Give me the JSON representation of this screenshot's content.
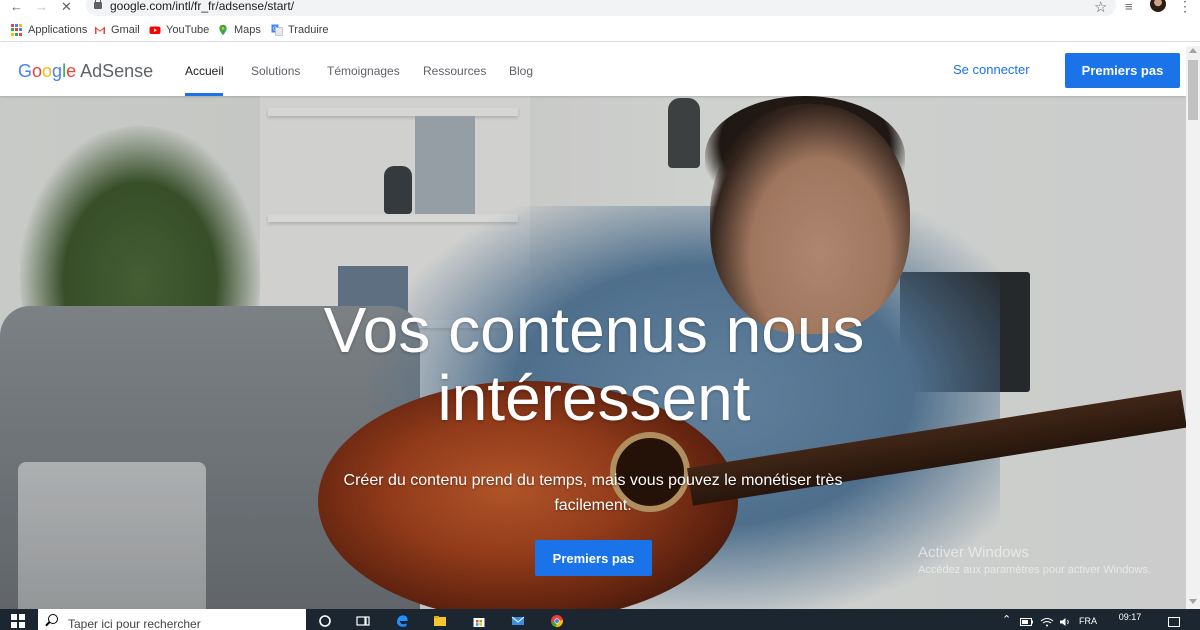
{
  "browser": {
    "url": "google.com/intl/fr_fr/adsense/start/",
    "bookmarks": [
      {
        "label": "Applications",
        "icon": "apps-grid-icon"
      },
      {
        "label": "Gmail",
        "icon": "gmail-icon"
      },
      {
        "label": "YouTube",
        "icon": "youtube-icon"
      },
      {
        "label": "Maps",
        "icon": "maps-pin-icon"
      },
      {
        "label": "Traduire",
        "icon": "translate-icon"
      }
    ]
  },
  "header": {
    "logo_google": [
      "G",
      "o",
      "o",
      "g",
      "l",
      "e"
    ],
    "logo_product": "AdSense",
    "nav": [
      {
        "label": "Accueil",
        "active": true
      },
      {
        "label": "Solutions",
        "active": false
      },
      {
        "label": "Témoignages",
        "active": false
      },
      {
        "label": "Ressources",
        "active": false
      },
      {
        "label": "Blog",
        "active": false
      }
    ],
    "signin_label": "Se connecter",
    "cta_label": "Premiers pas"
  },
  "hero": {
    "title_line1": "Vos contenus nous",
    "title_line2": "intéressent",
    "subtitle": "Créer du contenu prend du temps, mais vous pouvez le monétiser très facilement.",
    "cta_label": "Premiers pas"
  },
  "watermark": {
    "title": "Activer Windows",
    "subtitle": "Accédez aux paramètres pour activer Windows."
  },
  "taskbar": {
    "search_placeholder": "Taper ici pour rechercher",
    "language": "FRA",
    "time": "09:17"
  },
  "colors": {
    "accent": "#1a73e8",
    "google_blue": "#4285f4",
    "google_red": "#ea4335",
    "google_yellow": "#fbbc05",
    "google_green": "#34a853",
    "taskbar": "#1b2630"
  }
}
